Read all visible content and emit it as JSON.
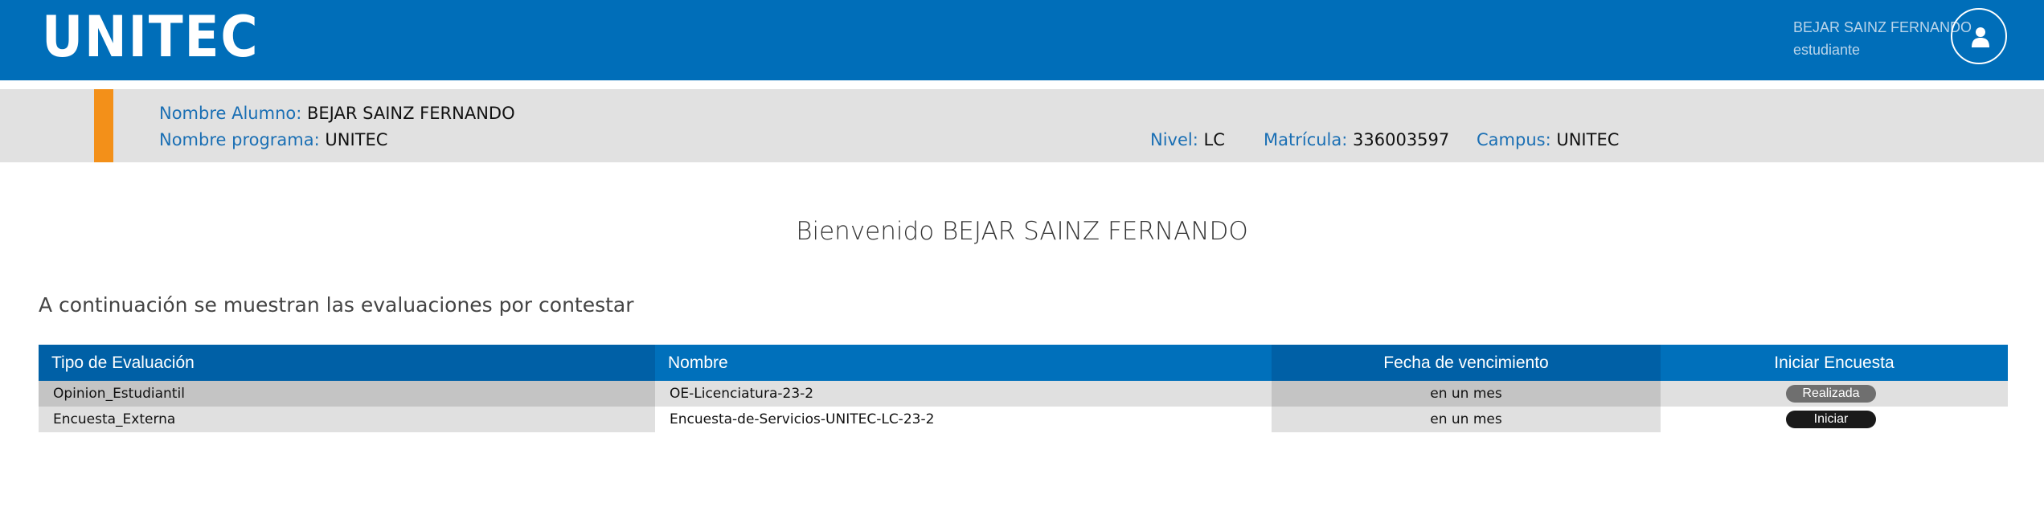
{
  "header": {
    "logo": "UNITEC",
    "user_name": "BEJAR SAINZ FERNANDO",
    "user_role": "estudiante",
    "avatar_icon": "user-icon"
  },
  "student": {
    "name_label": "Nombre Alumno:",
    "name_value": "BEJAR SAINZ FERNANDO",
    "program_label": "Nombre programa:",
    "program_value": "UNITEC",
    "level_label": "Nivel:",
    "level_value": "LC",
    "id_label": "Matrícula:",
    "id_value": "336003597",
    "campus_label": "Campus:",
    "campus_value": "UNITEC"
  },
  "main": {
    "welcome": "Bienvenido BEJAR SAINZ FERNANDO",
    "intro": "A continuación se muestran las evaluaciones por contestar"
  },
  "table": {
    "headers": [
      "Tipo de Evaluación",
      "Nombre",
      "Fecha de vencimiento",
      "Iniciar Encuesta"
    ],
    "rows": [
      {
        "type": "Opinion_Estudiantil",
        "name": "OE-Licenciatura-23-2",
        "due": "en un mes",
        "action": "Realizada"
      },
      {
        "type": "Encuesta_Externa",
        "name": "Encuesta-de-Servicios-UNITEC-LC-23-2",
        "due": "en un mes",
        "action": "Iniciar"
      }
    ]
  },
  "colors": {
    "brand_blue": "#006eb9",
    "accent_orange": "#f39019",
    "label_blue": "#1a6fb4"
  }
}
